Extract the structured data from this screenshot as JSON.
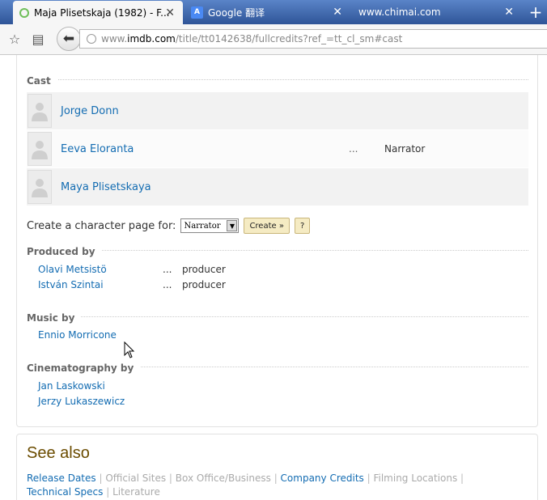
{
  "tabs": [
    {
      "title": "Maja Plisetskaja (1982) - F...",
      "active": true,
      "icon": "loading-spinner-icon"
    },
    {
      "title": "Google 翻译",
      "active": false,
      "icon": "google-translate-icon"
    },
    {
      "title": "www.chimai.com",
      "active": false,
      "icon": ""
    }
  ],
  "tab_close": "✕",
  "new_tab": "+",
  "url": {
    "prefix": "www.",
    "domain": "imdb.com",
    "path": "/title/tt0142638/fullcredits?ref_=tt_cl_sm#cast"
  },
  "cast": {
    "heading": "Cast",
    "rows": [
      {
        "name": "Jorge Donn",
        "dots": "",
        "role": ""
      },
      {
        "name": "Eeva Eloranta",
        "dots": "...",
        "role": "Narrator"
      },
      {
        "name": "Maya Plisetskaya",
        "dots": "",
        "role": ""
      }
    ],
    "character_label": "Create a character page for:",
    "character_select": "Narrator",
    "create_button": "Create »",
    "help_button": "?"
  },
  "produced_by": {
    "heading": "Produced by",
    "rows": [
      {
        "name": "Olavi Metsistö",
        "dots": "...",
        "role": "producer"
      },
      {
        "name": "István Szintai",
        "dots": "...",
        "role": "producer"
      }
    ]
  },
  "music_by": {
    "heading": "Music by",
    "rows": [
      {
        "name": "Ennio Morricone"
      }
    ]
  },
  "cinematography_by": {
    "heading": "Cinematography by",
    "rows": [
      {
        "name": "Jan Laskowski"
      },
      {
        "name": "Jerzy Lukaszewicz"
      }
    ]
  },
  "see_also": {
    "heading": "See also",
    "links": [
      {
        "label": "Release Dates",
        "active": true
      },
      {
        "label": "Official Sites",
        "active": false
      },
      {
        "label": "Box Office/Business",
        "active": false
      },
      {
        "label": "Company Credits",
        "active": true
      },
      {
        "label": "Filming Locations",
        "active": false
      },
      {
        "label": "Technical Specs",
        "active": true
      },
      {
        "label": "Literature",
        "active": false
      }
    ]
  },
  "colors": {
    "link": "#136cb2",
    "see_also_heading": "#6b4c00",
    "tabbar": "#3b63a8"
  }
}
